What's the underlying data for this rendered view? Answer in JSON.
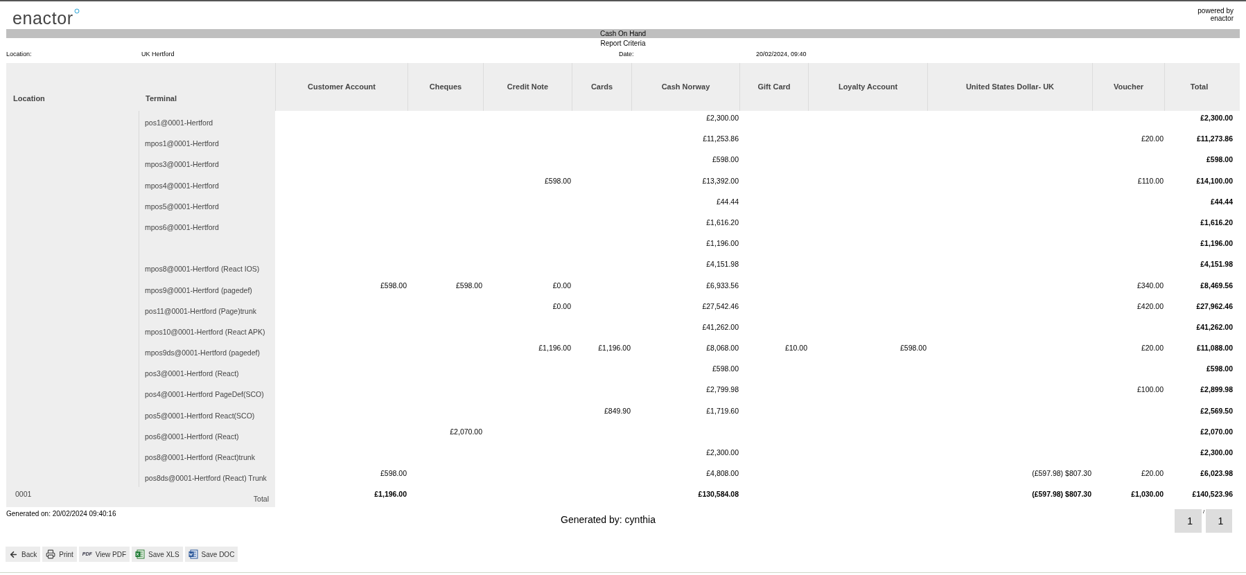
{
  "logo": "enactor",
  "powered_by": [
    "powered by",
    "enactor"
  ],
  "report": {
    "title": "Cash On Hand",
    "subtitle": "Report Criteria",
    "criteria": [
      {
        "label": "Location:",
        "value": "UK Hertford"
      },
      {
        "label": "Date:",
        "value": "20/02/2024, 09:40"
      }
    ]
  },
  "table": {
    "columns": [
      "Location",
      "Terminal",
      "Customer Account",
      "Cheques",
      "Credit Note",
      "Cards",
      "Cash Norway",
      "Gift Card",
      "Loyalty Account",
      "United States Dollar- UK",
      "Voucher",
      "Total"
    ],
    "rows": [
      {
        "terminal": "pos1@0001-Hertford",
        "cash_norway": "£2,300.00",
        "total": "£2,300.00"
      },
      {
        "terminal": "mpos1@0001-Hertford",
        "cash_norway": "£11,253.86",
        "voucher": "£20.00",
        "total": "£11,273.86"
      },
      {
        "terminal": "mpos3@0001-Hertford",
        "cash_norway": "£598.00",
        "total": "£598.00"
      },
      {
        "terminal": "mpos4@0001-Hertford",
        "credit_note": "£598.00",
        "cash_norway": "£13,392.00",
        "voucher": "£110.00",
        "total": "£14,100.00"
      },
      {
        "terminal": "mpos5@0001-Hertford",
        "cash_norway": "£44.44",
        "total": "£44.44"
      },
      {
        "terminal": "mpos6@0001-Hertford",
        "cash_norway": "£1,616.20",
        "total": "£1,616.20"
      },
      {
        "cash_norway": "£1,196.00",
        "total": "£1,196.00"
      },
      {
        "terminal": "mpos8@0001-Hertford (React IOS)",
        "cash_norway": "£4,151.98",
        "total": "£4,151.98"
      },
      {
        "terminal": "mpos9@0001-Hertford (pagedef)",
        "customer_account": "£598.00",
        "cheques": "£598.00",
        "credit_note": "£0.00",
        "cash_norway": "£6,933.56",
        "voucher": "£340.00",
        "total": "£8,469.56"
      },
      {
        "terminal": "pos11@0001-Hertford (Page)trunk",
        "credit_note": "£0.00",
        "cash_norway": "£27,542.46",
        "voucher": "£420.00",
        "total": "£27,962.46"
      },
      {
        "terminal": "mpos10@0001-Hertford (React APK)",
        "cash_norway": "£41,262.00",
        "total": "£41,262.00"
      },
      {
        "terminal": "mpos9ds@0001-Hertford (pagedef)",
        "credit_note": "£1,196.00",
        "cards": "£1,196.00",
        "cash_norway": "£8,068.00",
        "gift_card": "£10.00",
        "loyalty_account": "£598.00",
        "voucher": "£20.00",
        "total": "£11,088.00"
      },
      {
        "terminal": "pos3@0001-Hertford (React)",
        "cash_norway": "£598.00",
        "total": "£598.00"
      },
      {
        "terminal": "pos4@0001-Hertford PageDef(SCO)",
        "cash_norway": "£2,799.98",
        "voucher": "£100.00",
        "total": "£2,899.98"
      },
      {
        "terminal": "pos5@0001-Hertford React(SCO)",
        "cards": "£849.90",
        "cash_norway": "£1,719.60",
        "total": "£2,569.50"
      },
      {
        "terminal": "pos6@0001-Hertford (React)",
        "cheques": "£2,070.00",
        "total": "£2,070.00"
      },
      {
        "terminal": "pos8@0001-Hertford (React)trunk",
        "cash_norway": "£2,300.00",
        "total": "£2,300.00"
      },
      {
        "terminal": "pos8ds@0001-Hertford (React) Trunk",
        "customer_account": "£598.00",
        "cash_norway": "£4,808.00",
        "united_states_dollar_uk": "(£597.98) $807.30",
        "voucher": "£20.00",
        "total": "£6,023.98"
      }
    ],
    "total_row": {
      "location": "0001",
      "label": "Total",
      "customer_account": "£1,196.00",
      "cash_norway": "£130,584.08",
      "united_states_dollar_uk": "(£597.98) $807.30",
      "voucher": "£1,030.00",
      "total": "£140,523.96"
    }
  },
  "generated_on": "Generated on: 20/02/2024 09:40:16",
  "generated_by": "Generated by: cynthia",
  "pagination": {
    "current": "1",
    "separator": "/",
    "total": "1"
  },
  "toolbar": [
    {
      "kind": "back",
      "label": "Back"
    },
    {
      "kind": "print",
      "label": "Print"
    },
    {
      "kind": "pdf",
      "icon_text": "PDF",
      "label": "View PDF"
    },
    {
      "kind": "xls",
      "label": "Save XLS"
    },
    {
      "kind": "doc",
      "label": "Save DOC"
    }
  ]
}
